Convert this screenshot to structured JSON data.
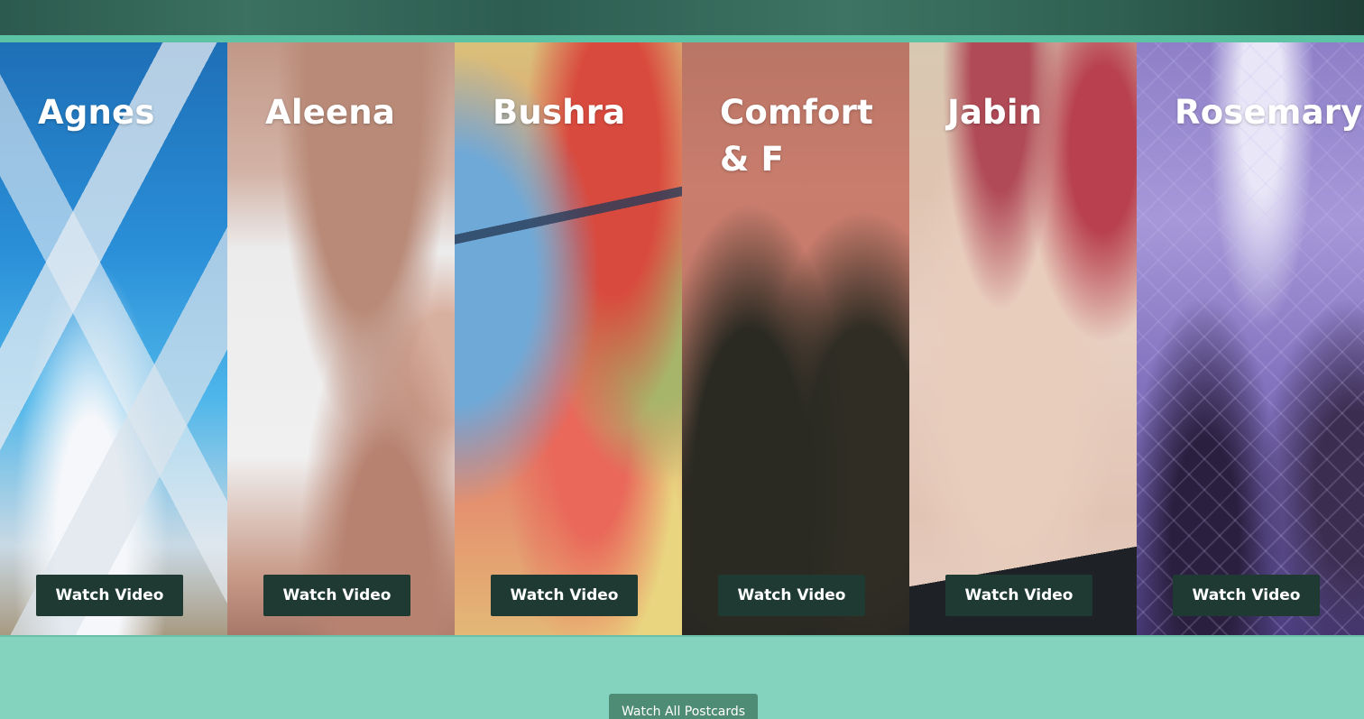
{
  "panels": [
    {
      "name": "Agnes",
      "button": "Watch Video"
    },
    {
      "name": "Aleena",
      "button": "Watch Video"
    },
    {
      "name": "Bushra",
      "button": "Watch Video"
    },
    {
      "name": "Comfort & F",
      "button": "Watch Video"
    },
    {
      "name": "Jabin",
      "button": "Watch Video"
    },
    {
      "name": "Rosemary",
      "button": "Watch Video"
    }
  ],
  "footer": {
    "watch_all_label": "Watch All Postcards"
  },
  "colors": {
    "accent_bar": "#5dc3a5",
    "button_dark": "#1e3a33",
    "page_background": "#84d3bf",
    "watch_all_button": "#4e8c75"
  }
}
